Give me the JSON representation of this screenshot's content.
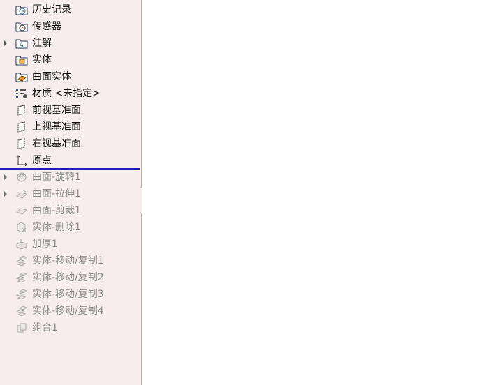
{
  "feature_tree": {
    "items": [
      {
        "label": "历史记录",
        "icon": "history-folder-icon",
        "expandable": false,
        "suppressed": false
      },
      {
        "label": "传感器",
        "icon": "sensor-folder-icon",
        "expandable": false,
        "suppressed": false
      },
      {
        "label": "注解",
        "icon": "annotation-folder-icon",
        "expandable": true,
        "suppressed": false
      },
      {
        "label": "实体",
        "icon": "solid-bodies-folder-icon",
        "expandable": false,
        "suppressed": false
      },
      {
        "label": "曲面实体",
        "icon": "surface-bodies-folder-icon",
        "expandable": false,
        "suppressed": false
      },
      {
        "label": "材质 <未指定>",
        "icon": "material-icon",
        "expandable": false,
        "suppressed": false
      },
      {
        "label": "前视基准面",
        "icon": "plane-icon",
        "expandable": false,
        "suppressed": false
      },
      {
        "label": "上视基准面",
        "icon": "plane-icon",
        "expandable": false,
        "suppressed": false
      },
      {
        "label": "右视基准面",
        "icon": "plane-icon",
        "expandable": false,
        "suppressed": false
      },
      {
        "label": "原点",
        "icon": "origin-icon",
        "expandable": false,
        "suppressed": false
      },
      {
        "label": "曲面-旋转1",
        "icon": "surface-revolve-icon",
        "expandable": true,
        "suppressed": true
      },
      {
        "label": "曲面-拉伸1",
        "icon": "surface-extrude-icon",
        "expandable": true,
        "suppressed": true
      },
      {
        "label": "曲面-剪裁1",
        "icon": "surface-trim-icon",
        "expandable": false,
        "suppressed": true
      },
      {
        "label": "实体-删除1",
        "icon": "delete-body-icon",
        "expandable": false,
        "suppressed": true
      },
      {
        "label": "加厚1",
        "icon": "thicken-icon",
        "expandable": false,
        "suppressed": true
      },
      {
        "label": "实体-移动/复制1",
        "icon": "move-copy-body-icon",
        "expandable": false,
        "suppressed": true
      },
      {
        "label": "实体-移动/复制2",
        "icon": "move-copy-body-icon",
        "expandable": false,
        "suppressed": true
      },
      {
        "label": "实体-移动/复制3",
        "icon": "move-copy-body-icon",
        "expandable": false,
        "suppressed": true
      },
      {
        "label": "实体-移动/复制4",
        "icon": "move-copy-body-icon",
        "expandable": false,
        "suppressed": true
      },
      {
        "label": "组合1",
        "icon": "combine-icon",
        "expandable": false,
        "suppressed": true
      }
    ]
  },
  "colors": {
    "tree_background": "#f6eeee",
    "rollback_bar": "#1f1fb8",
    "suppressed_text": "#8d8d8d"
  }
}
